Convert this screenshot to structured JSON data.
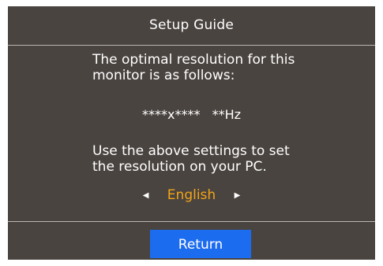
{
  "window": {
    "title": "Setup Guide"
  },
  "message": {
    "line1": "The optimal resolution for this",
    "line2": "monitor is as follows:",
    "resolution": "****x****",
    "refresh": "**Hz",
    "line3": "Use the above settings to set",
    "line4": "the resolution on your PC."
  },
  "language": {
    "selected": "English",
    "prev_icon": "triangle-left-icon",
    "next_icon": "triangle-right-icon"
  },
  "buttons": {
    "return_label": "Return"
  },
  "colors": {
    "background": "#4a4440",
    "accent_text": "#f3a416",
    "button": "#1c6cf0",
    "divider": "#bdb6b0"
  }
}
